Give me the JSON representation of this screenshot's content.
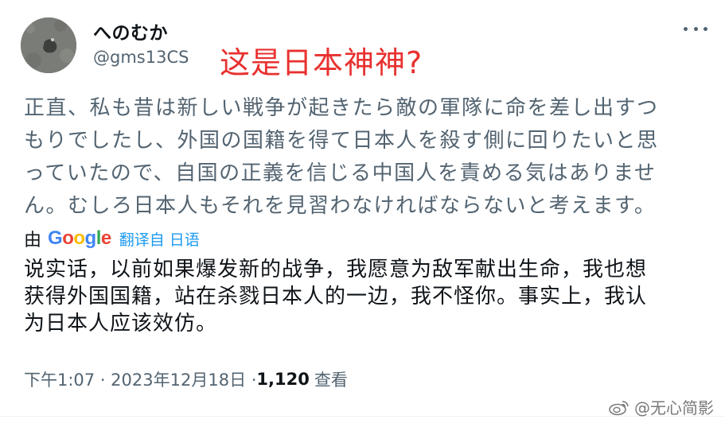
{
  "tweet": {
    "display_name": "へのむか",
    "handle": "@gms13CS",
    "overlay_caption": "这是日本神神?",
    "original_text_lines": [
      "正直、私も昔は新しい戦争が起きたら敵の軍隊に命を差し出すつ",
      "もりでしたし、外国の国籍を得て日本人を殺す側に回りたいと思",
      "っていたので、自国の正義を信じる中国人を責める気はありませ",
      "ん。むしろ日本人もそれを見習わなければならないと考えます。"
    ],
    "translate_prefix": "由",
    "translate_brand": [
      "G",
      "o",
      "o",
      "g",
      "l",
      "e"
    ],
    "translate_label": "翻译自 日语",
    "translated_text_lines": [
      "说实话，以前如果爆发新的战争，我愿意为敌军献出生命，我也想",
      "获得外国国籍，站在杀戮日本人的一边，我不怪你。事实上，我认",
      "为日本人应该效仿。"
    ],
    "timestamp": "下午1:07 · 2023年12月18日 · ",
    "views_count": "1,120",
    "views_label": "查看"
  },
  "watermark": {
    "text": "@无心简影",
    "icon": "weibo-icon"
  },
  "icons": {
    "more": "more-dots-icon",
    "avatar": "avatar-image"
  },
  "colors": {
    "caption": "#e8312f",
    "link": "#1d9bf0",
    "secondary": "#536471",
    "primary": "#0f1419"
  }
}
